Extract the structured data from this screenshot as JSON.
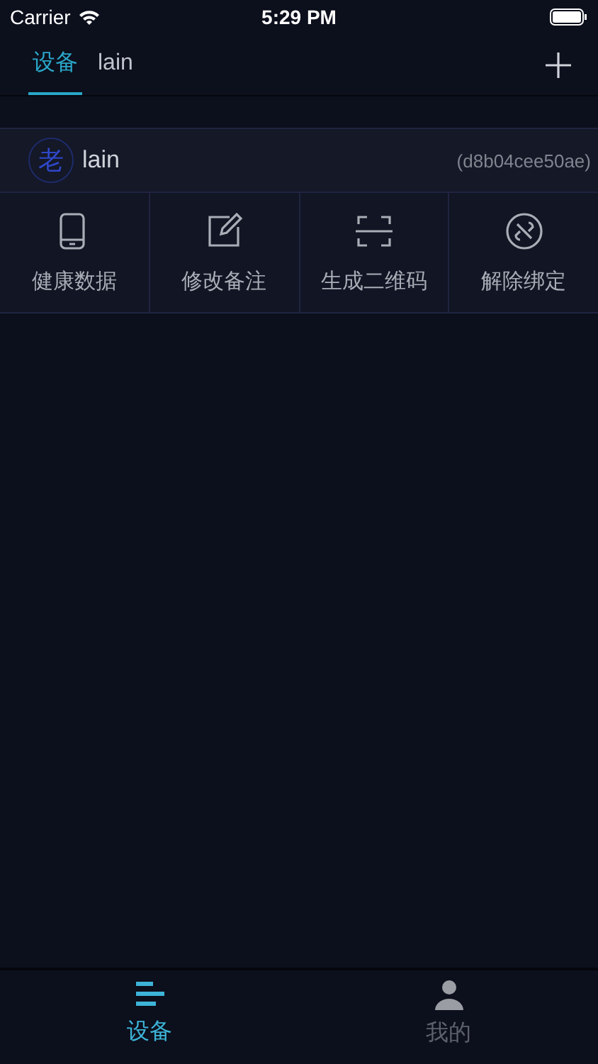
{
  "status_bar": {
    "carrier": "Carrier",
    "time": "5:29 PM"
  },
  "top_tabs": [
    {
      "label": "设备",
      "selected": true
    },
    {
      "label": "lain",
      "selected": false
    }
  ],
  "device": {
    "avatar": "老",
    "name": "lain",
    "id": "(d8b04cee50ae)"
  },
  "actions": [
    {
      "label": "健康数据"
    },
    {
      "label": "修改备注"
    },
    {
      "label": "生成二维码"
    },
    {
      "label": "解除绑定"
    }
  ],
  "tab_bar": [
    {
      "label": "设备",
      "selected": true
    },
    {
      "label": "我的",
      "selected": false
    }
  ]
}
